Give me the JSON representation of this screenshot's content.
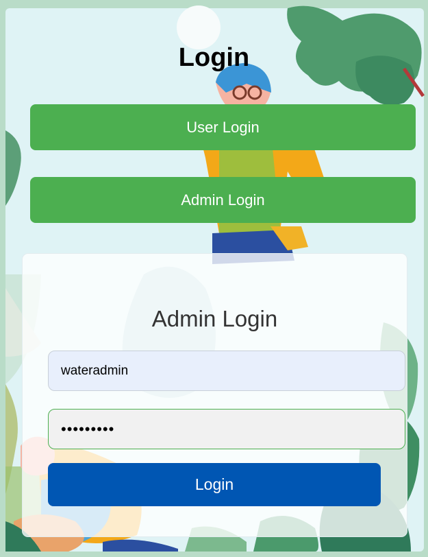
{
  "page": {
    "title": "Login"
  },
  "nav": {
    "user_login_label": "User Login",
    "admin_login_label": "Admin Login"
  },
  "admin_form": {
    "heading": "Admin Login",
    "username_value": "wateradmin",
    "password_value": "waterpass",
    "submit_label": "Login"
  },
  "theme": {
    "green_button": "#4caf50",
    "submit_button": "#0056b3",
    "background": "#d9f1f4"
  }
}
